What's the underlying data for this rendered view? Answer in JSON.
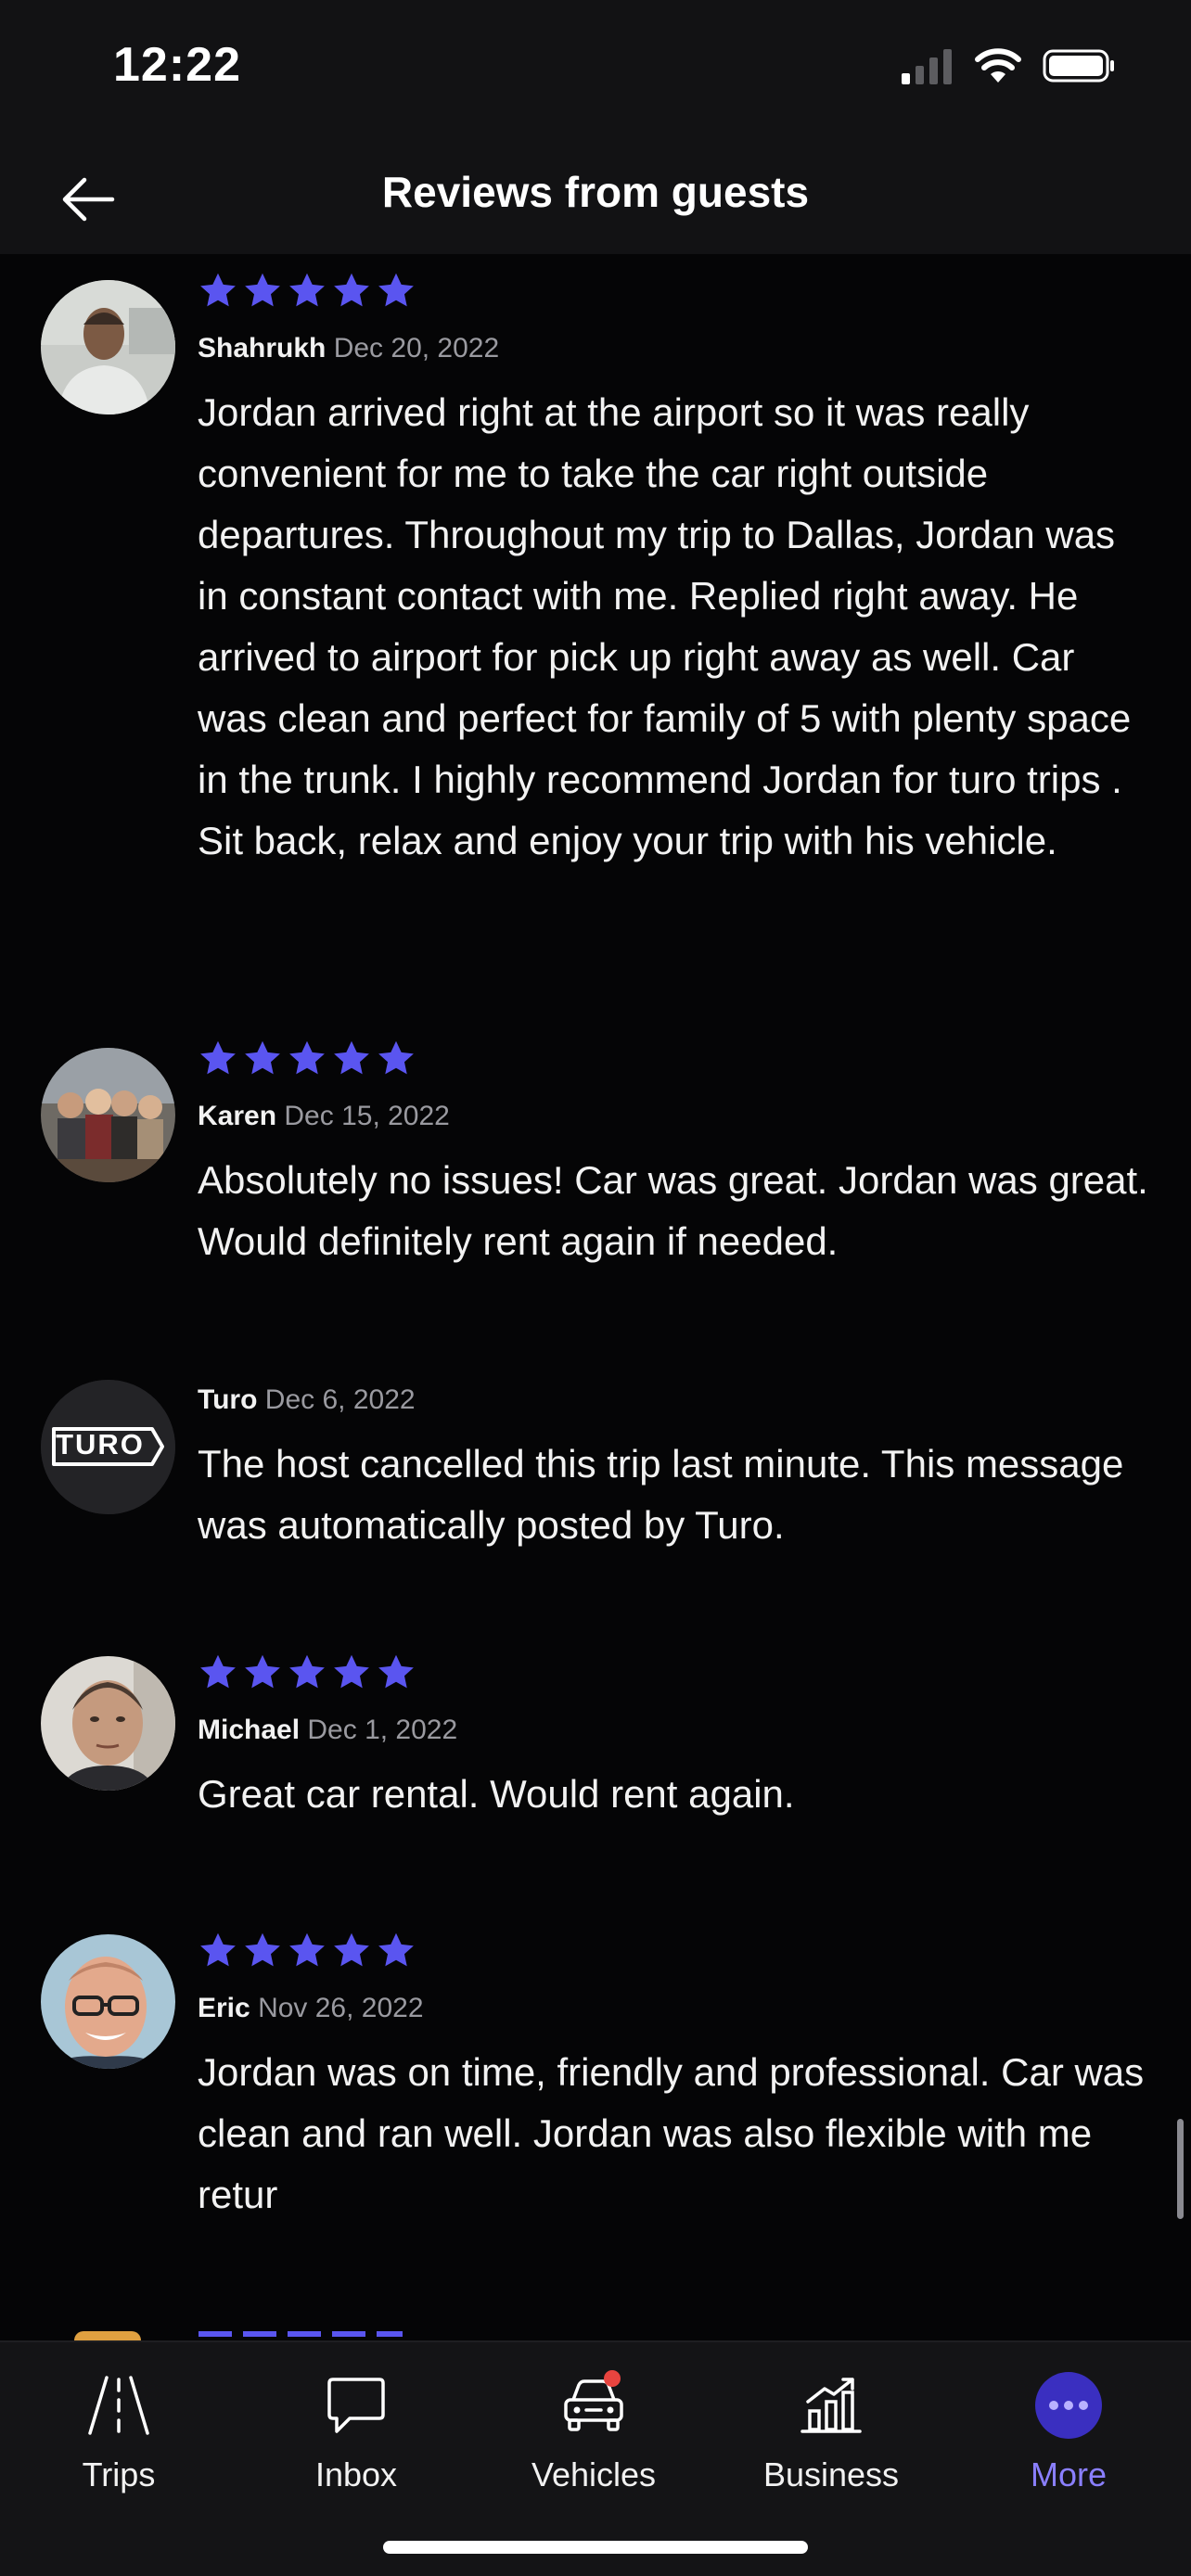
{
  "status_bar": {
    "time": "12:22"
  },
  "header": {
    "title": "Reviews from guests"
  },
  "colors": {
    "star": "#5a55f0",
    "accent": "#8a7fff",
    "badge": "#e8443f"
  },
  "reviews": [
    {
      "stars": 5,
      "name": "Shahrukh",
      "date": "Dec 20, 2022",
      "text": "Jordan arrived right at the airport so it was really convenient for me to take the car right outside departures. Throughout my trip to Dallas, Jordan was in constant contact with me. Replied right away. He arrived to airport for pick up right away as well. Car was clean and perfect for family of 5 with plenty space in the trunk. I highly recommend Jordan for turo trips . Sit back, relax and enjoy your trip with his vehicle."
    },
    {
      "stars": 5,
      "name": "Karen",
      "date": "Dec 15, 2022",
      "text": "Absolutely no issues! Car was great. Jordan was great. Would definitely rent again if needed."
    },
    {
      "stars": 0,
      "name": "Turo",
      "date": "Dec 6, 2022",
      "logo_text": "TURO",
      "text": "The host cancelled this trip last minute. This message was automatically posted by Turo."
    },
    {
      "stars": 5,
      "name": "Michael",
      "date": "Dec 1, 2022",
      "text": "Great car rental. Would rent again."
    },
    {
      "stars": 5,
      "name": "Eric",
      "date": "Nov 26, 2022",
      "text": "Jordan was on time, friendly and professional. Car was clean and ran well. Jordan was also flexible with me retur"
    }
  ],
  "tab_bar": {
    "tabs": [
      {
        "label": "Trips",
        "icon": "road-icon"
      },
      {
        "label": "Inbox",
        "icon": "chat-bubble-icon"
      },
      {
        "label": "Vehicles",
        "icon": "car-icon",
        "badge": true
      },
      {
        "label": "Business",
        "icon": "bar-chart-icon"
      },
      {
        "label": "More",
        "icon": "more-dots-icon",
        "active": true
      }
    ]
  }
}
